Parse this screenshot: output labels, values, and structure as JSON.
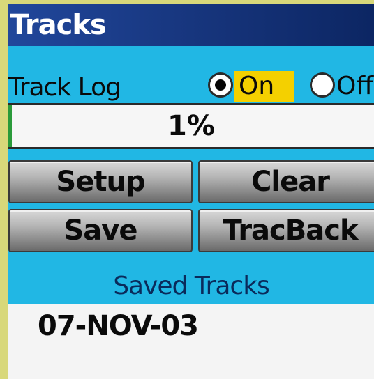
{
  "title": "Tracks",
  "track_log": {
    "label": "Track Log",
    "options": [
      {
        "label": "On",
        "selected": true
      },
      {
        "label": "Off",
        "selected": false
      }
    ]
  },
  "progress": {
    "label": "1%",
    "percent": 1
  },
  "buttons": {
    "setup": "Setup",
    "clear": "Clear",
    "save": "Save",
    "tracback": "TracBack"
  },
  "saved_tracks": {
    "header": "Saved Tracks",
    "items": [
      "07-NOV-03"
    ]
  },
  "colors": {
    "title_bar": "#16347b",
    "panel": "#21b7e4",
    "highlight": "#f4d000",
    "outer": "#d8d87a"
  }
}
